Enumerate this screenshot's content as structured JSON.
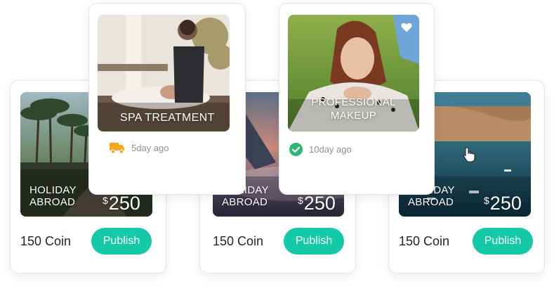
{
  "colors": {
    "accent": "#14c9a6",
    "truck": "#f5a623",
    "check": "#2eb872"
  },
  "cards": [
    {
      "label_line1": "HOLIDAY",
      "label_line2": "ABROAD",
      "currency": "$",
      "price": "250",
      "coin": "150 Coin",
      "button": "Publish"
    },
    {
      "label_line1": "HOLIDAY",
      "label_line2": "ABROAD",
      "currency": "$",
      "price": "250",
      "coin": "150 Coin",
      "button": "Publish"
    },
    {
      "label_line1": "HOLIDAY",
      "label_line2": "ABROAD",
      "currency": "$",
      "price": "250",
      "coin": "150 Coin",
      "button": "Publish"
    }
  ],
  "spa_card": {
    "title": "SPA TREATMENT",
    "status_icon": "truck-icon",
    "time": "5day ago"
  },
  "makeup_card": {
    "title_line1": "PROFESSIONAL",
    "title_line2": "MAKEUP",
    "status_icon": "check-circle-icon",
    "favorite_icon": "heart-icon",
    "time": "10day ago"
  },
  "cursor_icon": "hand-pointer-icon"
}
